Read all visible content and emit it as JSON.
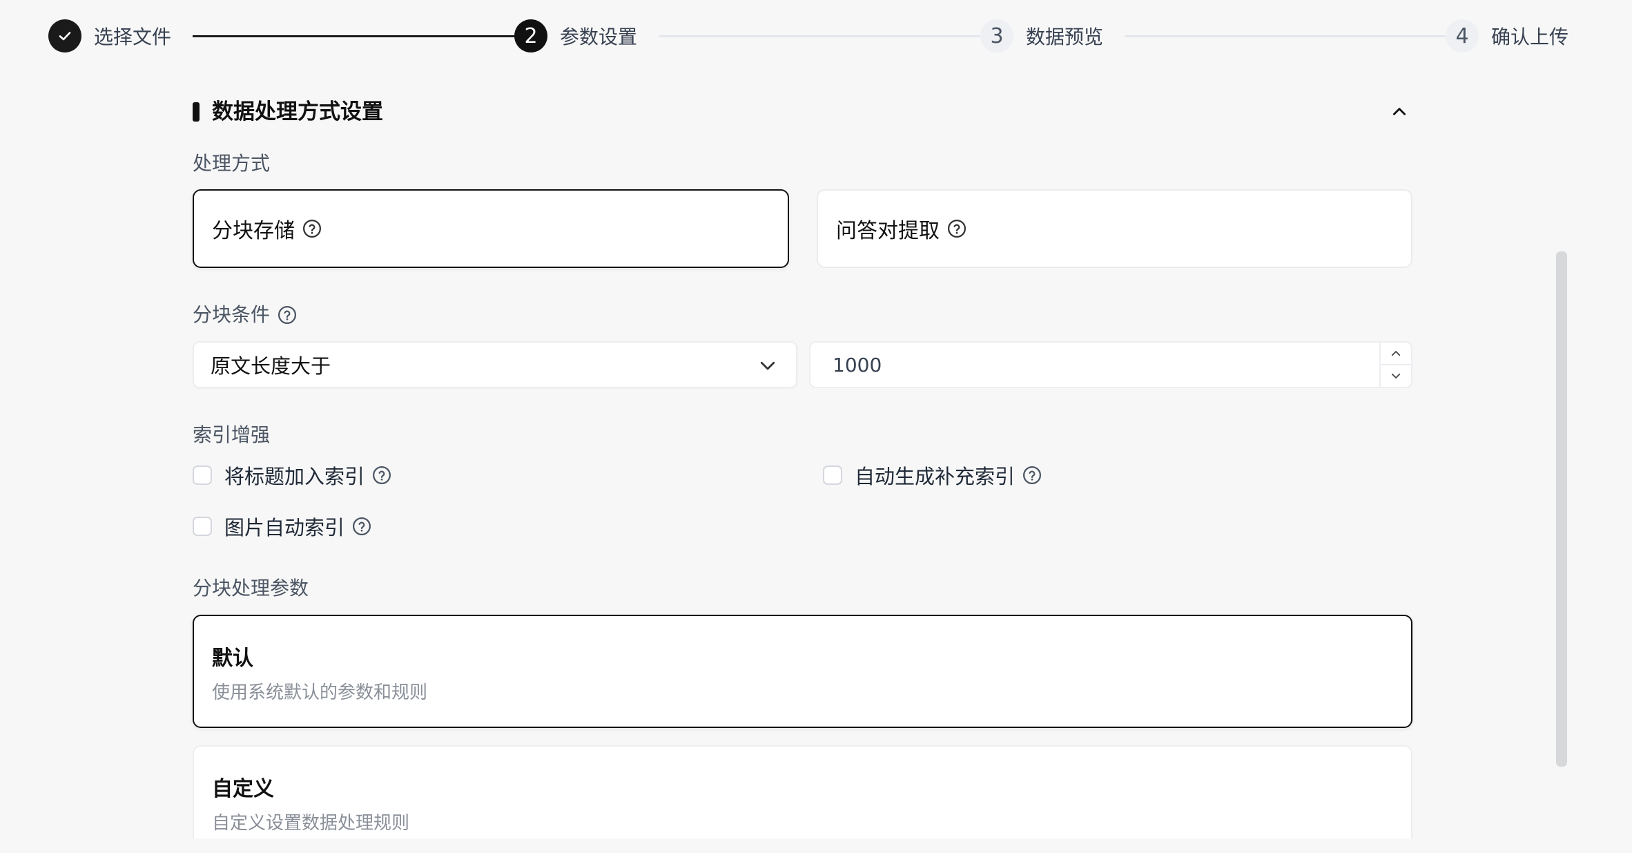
{
  "stepper": {
    "steps": [
      {
        "number": "",
        "label": "选择文件",
        "state": "done",
        "icon": "check-icon"
      },
      {
        "number": "2",
        "label": "参数设置",
        "state": "active"
      },
      {
        "number": "3",
        "label": "数据预览",
        "state": "pending"
      },
      {
        "number": "4",
        "label": "确认上传",
        "state": "pending"
      }
    ]
  },
  "section": {
    "title": "数据处理方式设置",
    "collapse_icon": "chevron-up-icon"
  },
  "processing": {
    "label": "处理方式",
    "options": [
      {
        "label": "分块存储",
        "selected": true,
        "icon": "help-circle-icon"
      },
      {
        "label": "问答对提取",
        "selected": false,
        "icon": "help-circle-icon"
      }
    ]
  },
  "chunk_condition": {
    "label": "分块条件",
    "select_value": "原文长度大于",
    "number_value": "1000"
  },
  "index_enhance": {
    "label": "索引增强",
    "options": [
      {
        "label": "将标题加入索引",
        "checked": false
      },
      {
        "label": "自动生成补充索引",
        "checked": false
      },
      {
        "label": "图片自动索引",
        "checked": false
      }
    ]
  },
  "chunk_params": {
    "label": "分块处理参数",
    "options": [
      {
        "title": "默认",
        "desc": "使用系统默认的参数和规则",
        "selected": true
      },
      {
        "title": "自定义",
        "desc": "自定义设置数据处理规则",
        "selected": false
      }
    ]
  },
  "colors": {
    "accent": "#111111",
    "background": "#f7f7f7",
    "muted_text": "#8a8f98",
    "border": "#eceef1"
  }
}
